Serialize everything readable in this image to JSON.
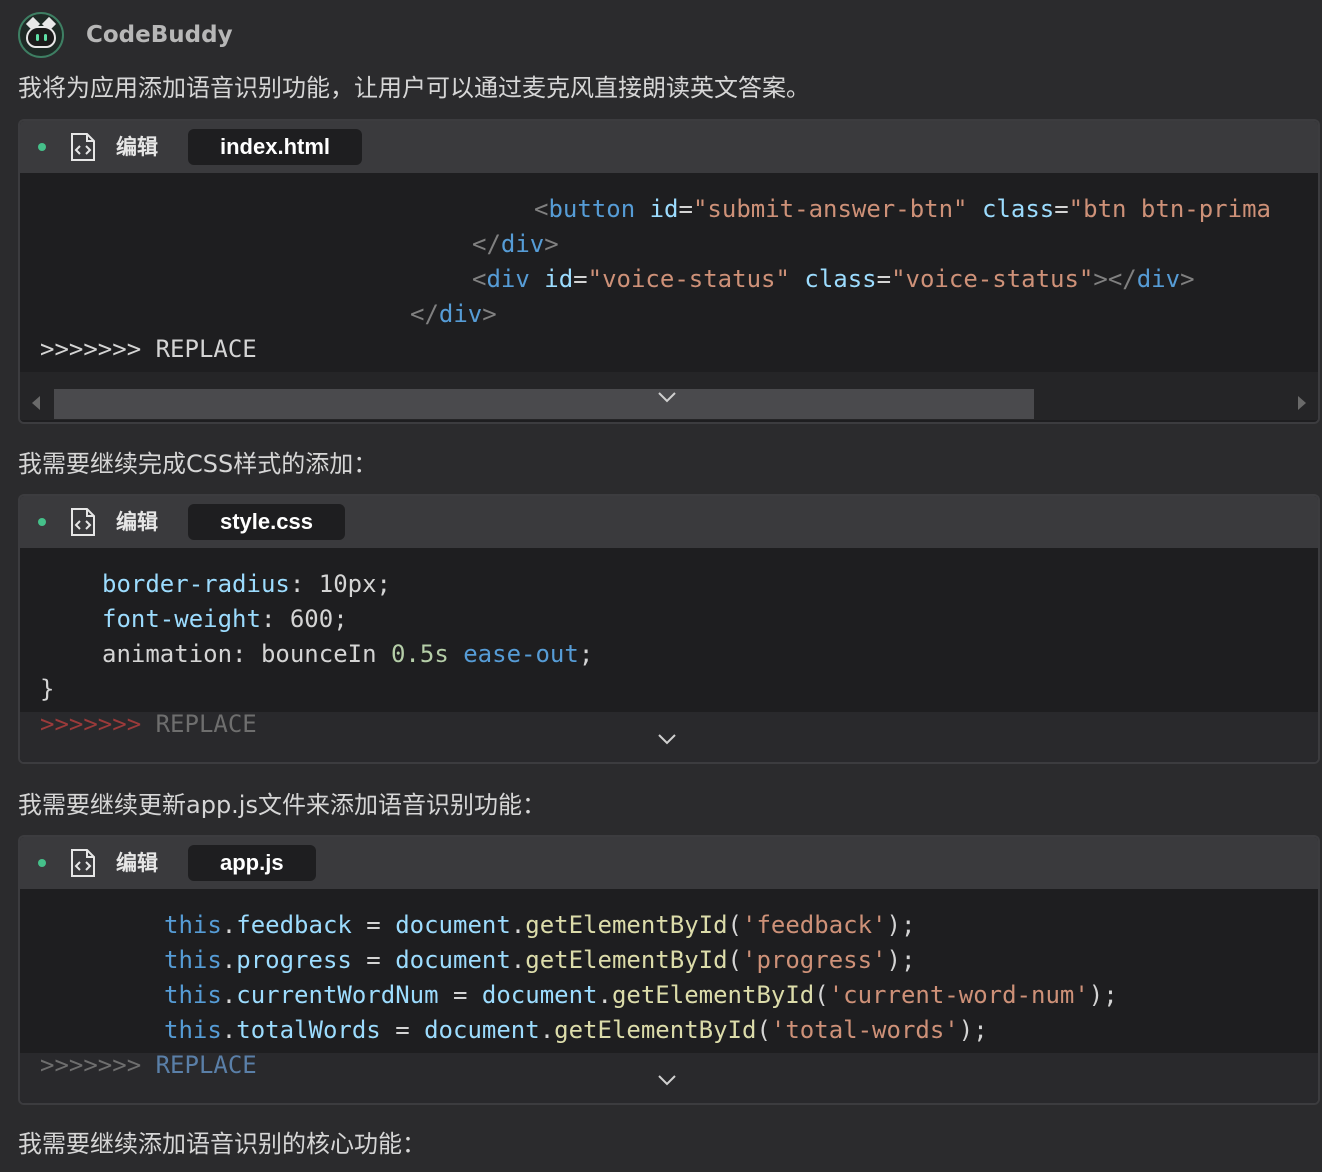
{
  "app": {
    "name": "CodeBuddy",
    "avatar_icon": "robot-cat-avatar"
  },
  "messages": [
    "我将为应用添加语音识别功能，让用户可以通过麦克风直接朗读英文答案。",
    "我需要继续完成CSS样式的添加：",
    "我需要继续更新app.js文件来添加语音识别功能：",
    "我需要继续添加语音识别的核心功能："
  ],
  "cards": [
    {
      "action_label": "编辑",
      "file_name": "index.html",
      "status_color": "#45c08a",
      "lines": [
        [
          [
            "tag",
            "<"
          ],
          [
            "tn",
            "button"
          ],
          [
            "wh",
            " "
          ],
          [
            "at",
            "id"
          ],
          [
            "wh",
            "="
          ],
          [
            "st",
            "\"submit-answer-btn\""
          ],
          [
            "wh",
            " "
          ],
          [
            "at",
            "class"
          ],
          [
            "wh",
            "="
          ],
          [
            "st",
            "\"btn btn-prima"
          ]
        ],
        [
          [
            "tag",
            "</"
          ],
          [
            "tn",
            "div"
          ],
          [
            "tag",
            ">"
          ]
        ],
        [
          [
            "tag",
            "<"
          ],
          [
            "tn",
            "div"
          ],
          [
            "wh",
            " "
          ],
          [
            "at",
            "id"
          ],
          [
            "wh",
            "="
          ],
          [
            "st",
            "\"voice-status\""
          ],
          [
            "wh",
            " "
          ],
          [
            "at",
            "class"
          ],
          [
            "wh",
            "="
          ],
          [
            "st",
            "\"voice-status\""
          ],
          [
            "tag",
            "></"
          ],
          [
            "tn",
            "div"
          ],
          [
            "tag",
            ">"
          ]
        ],
        [
          [
            "tag",
            "</"
          ],
          [
            "tn",
            "div"
          ],
          [
            "tag",
            ">"
          ]
        ],
        [
          [
            "wh",
            ">>>>>>> REPLACE"
          ]
        ]
      ]
    },
    {
      "action_label": "编辑",
      "file_name": "style.css",
      "status_color": "#45c08a",
      "lines": [
        [
          [
            "pr",
            "border-radius"
          ],
          [
            "wh",
            ": 10px;"
          ]
        ],
        [
          [
            "pr",
            "font-weight"
          ],
          [
            "wh",
            ": 600;"
          ]
        ],
        [
          [
            "wh",
            "animation: bounceIn "
          ],
          [
            "nm",
            "0.5s"
          ],
          [
            "wh",
            " "
          ],
          [
            "kw",
            "ease-out"
          ],
          [
            "wh",
            ";"
          ]
        ],
        [
          [
            "wh",
            "}"
          ]
        ],
        [
          [
            "rep-red",
            ">>>>>>>"
          ],
          [
            "rep-dim",
            " REPLACE"
          ]
        ]
      ]
    },
    {
      "action_label": "编辑",
      "file_name": "app.js",
      "status_color": "#45c08a",
      "lines": [
        [
          [
            "kw",
            "this"
          ],
          [
            "wh",
            "."
          ],
          [
            "pr",
            "feedback"
          ],
          [
            "wh",
            " = "
          ],
          [
            "pr",
            "document"
          ],
          [
            "wh",
            "."
          ],
          [
            "fn",
            "getElementById"
          ],
          [
            "wh",
            "("
          ],
          [
            "st",
            "'feedback'"
          ],
          [
            "wh",
            ");"
          ]
        ],
        [
          [
            "kw",
            "this"
          ],
          [
            "wh",
            "."
          ],
          [
            "pr",
            "progress"
          ],
          [
            "wh",
            " = "
          ],
          [
            "pr",
            "document"
          ],
          [
            "wh",
            "."
          ],
          [
            "fn",
            "getElementById"
          ],
          [
            "wh",
            "("
          ],
          [
            "st",
            "'progress'"
          ],
          [
            "wh",
            ");"
          ]
        ],
        [
          [
            "kw",
            "this"
          ],
          [
            "wh",
            "."
          ],
          [
            "pr",
            "currentWordNum"
          ],
          [
            "wh",
            " = "
          ],
          [
            "pr",
            "document"
          ],
          [
            "wh",
            "."
          ],
          [
            "fn",
            "getElementById"
          ],
          [
            "wh",
            "("
          ],
          [
            "st",
            "'current-word-num'"
          ],
          [
            "wh",
            ");"
          ]
        ],
        [
          [
            "kw",
            "this"
          ],
          [
            "wh",
            "."
          ],
          [
            "pr",
            "totalWords"
          ],
          [
            "wh",
            " = "
          ],
          [
            "pr",
            "document"
          ],
          [
            "wh",
            "."
          ],
          [
            "fn",
            "getElementById"
          ],
          [
            "wh",
            "("
          ],
          [
            "st",
            "'total-words'"
          ],
          [
            "wh",
            ");"
          ]
        ],
        [
          [
            "rep-dim",
            ">>>>>>>"
          ],
          [
            "rep-blue",
            " REPLACE"
          ]
        ]
      ]
    }
  ],
  "icons": {
    "status_dot": "status-dot-icon",
    "file_code": "file-code-icon",
    "expand": "chevron-down-icon",
    "scroll_left": "scroll-left-arrow-icon",
    "scroll_right": "scroll-right-arrow-icon"
  }
}
